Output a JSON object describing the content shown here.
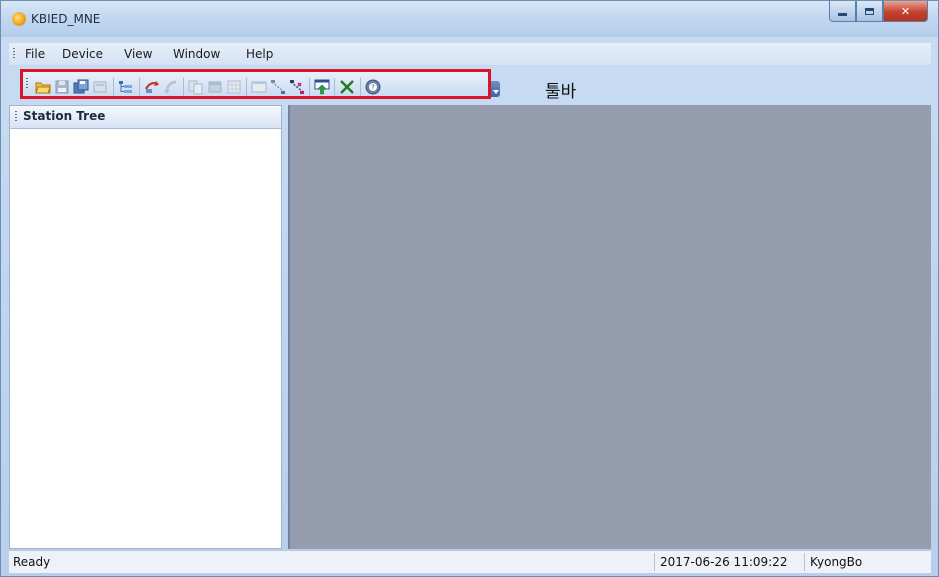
{
  "window": {
    "title": "KBIED_MNE"
  },
  "menu": {
    "items": [
      "File",
      "Device",
      "View",
      "Window",
      "Help"
    ]
  },
  "toolbar": {
    "annotation": "툴바",
    "icons": [
      "open-folder-icon",
      "save-icon",
      "save-all-icon",
      "print-preview-icon",
      "tree-view-icon",
      "upload-icon",
      "download-icon",
      "compare-icon",
      "properties-icon",
      "grid-icon",
      "window-icon",
      "connect-icon",
      "disconnect-icon",
      "export-icon",
      "delete-icon",
      "help-icon"
    ]
  },
  "tree": {
    "title": "Station Tree"
  },
  "status": {
    "ready": "Ready",
    "datetime": "2017-06-26 11:09:22",
    "user": "KyongBo"
  }
}
